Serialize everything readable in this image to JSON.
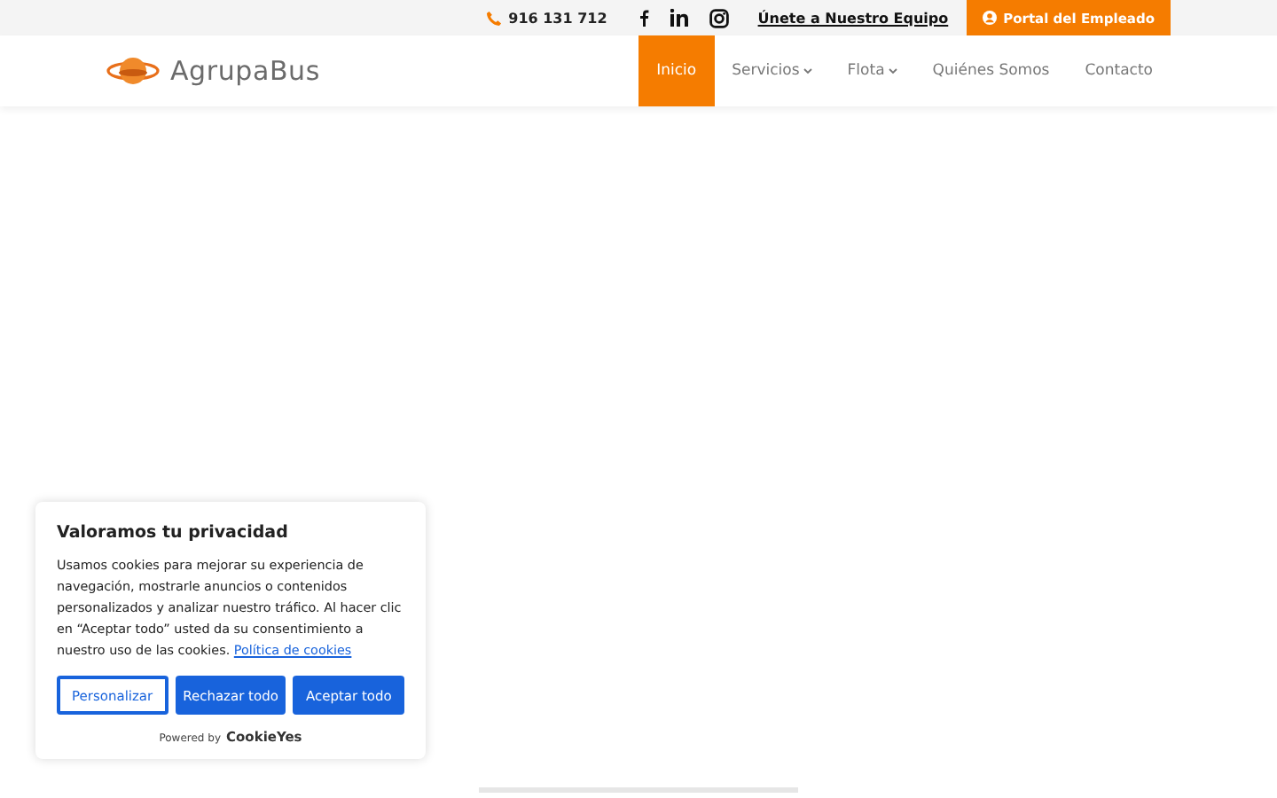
{
  "top_bar": {
    "phone": "916 131 712",
    "social": [
      {
        "kind": "facebook"
      },
      {
        "kind": "linkedin"
      },
      {
        "kind": "instagram"
      }
    ],
    "join_link": "Únete a Nuestro Equipo",
    "portal_button": "Portal del Empleado"
  },
  "header": {
    "logo_text": "AgrupaBus",
    "nav": [
      {
        "label": "Inicio",
        "selected": true,
        "dropdown": false
      },
      {
        "label": "Servicios",
        "selected": false,
        "dropdown": true
      },
      {
        "label": "Flota",
        "selected": false,
        "dropdown": true
      },
      {
        "label": "Quiénes Somos",
        "selected": false,
        "dropdown": false
      },
      {
        "label": "Contacto",
        "selected": false,
        "dropdown": false
      }
    ]
  },
  "cookie_banner": {
    "title": "Valoramos tu privacidad",
    "text": "Usamos cookies para mejorar su experiencia de navegación, mostrarle anuncios o contenidos personalizados y analizar nuestro tráfico. Al hacer clic en “Aceptar todo” usted da su consentimiento a nuestro uso de las cookies.",
    "link": "Política de cookies",
    "buttons": [
      {
        "label": "Personalizar",
        "kind": "outline"
      },
      {
        "label": "Rechazar todo",
        "kind": "filled"
      },
      {
        "label": "Aceptar todo",
        "kind": "filled"
      }
    ],
    "powered_by": "Powered by",
    "brand": "CookieYes"
  }
}
